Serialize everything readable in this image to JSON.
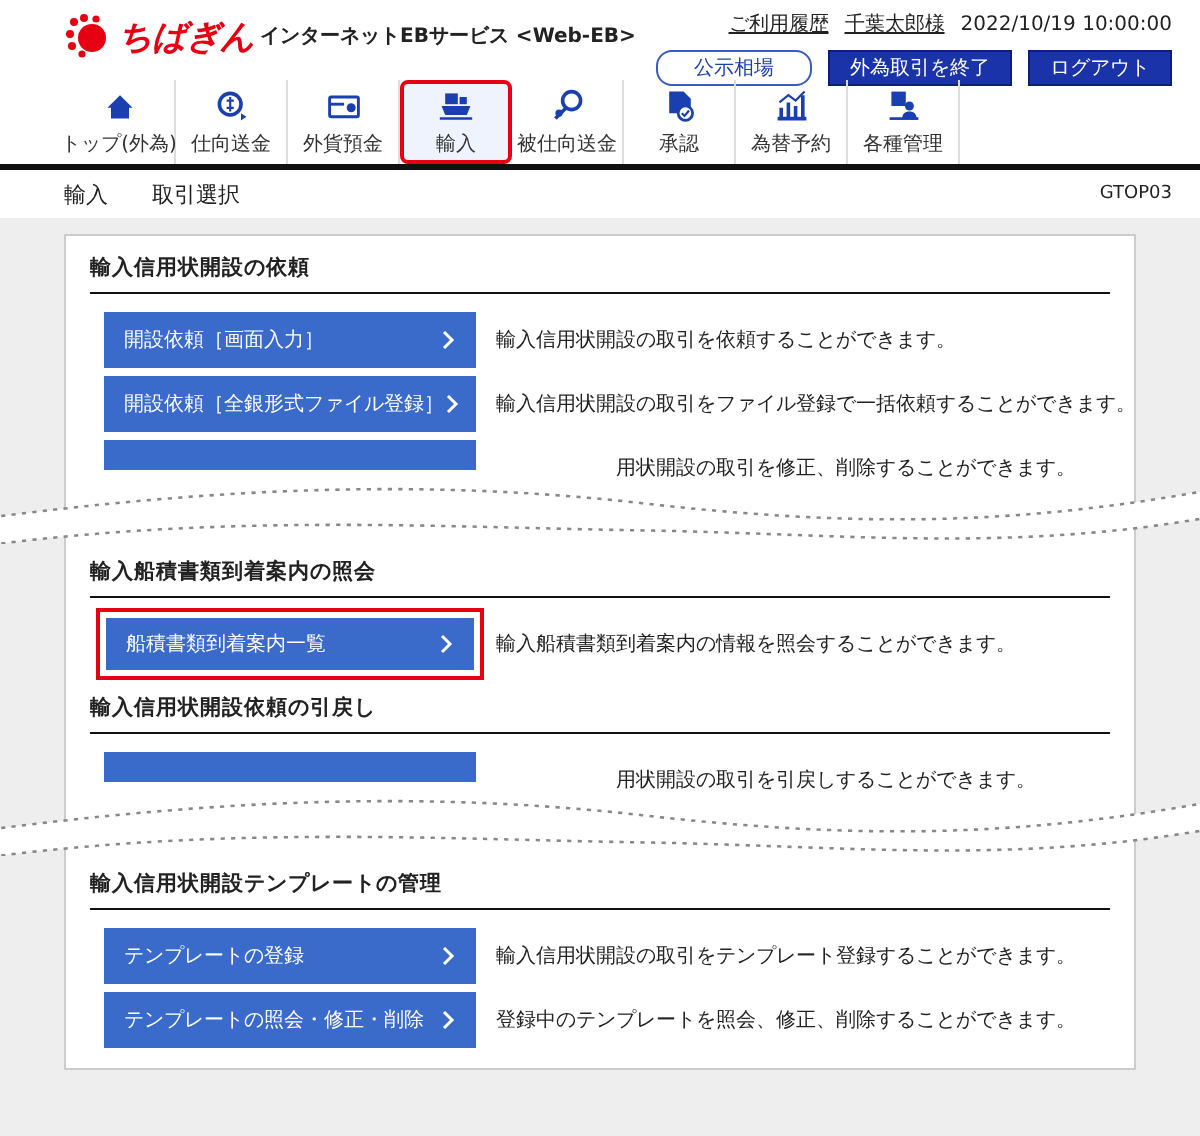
{
  "header": {
    "logo_text": "ちばぎん",
    "service_name": "インターネットEBサービス <Web-EB>",
    "links": [
      "ご利用履歴",
      "千葉太郎様"
    ],
    "datetime": "2022/10/19 10:00:00",
    "buttons": [
      {
        "label": "公示相場",
        "kind": "outline"
      },
      {
        "label": "外為取引を終了",
        "kind": "solid"
      },
      {
        "label": "ログアウト",
        "kind": "solid"
      }
    ]
  },
  "nav": [
    {
      "label": "トップ(外為)",
      "selected": false
    },
    {
      "label": "仕向送金",
      "selected": false
    },
    {
      "label": "外貨預金",
      "selected": false
    },
    {
      "label": "輸入",
      "selected": true
    },
    {
      "label": "被仕向送金",
      "selected": false
    },
    {
      "label": "承認",
      "selected": false
    },
    {
      "label": "為替予約",
      "selected": false
    },
    {
      "label": "各種管理",
      "selected": false
    }
  ],
  "breadcrumb": [
    "輸入",
    "取引選択"
  ],
  "screen_id": "GTOP03",
  "sections": [
    {
      "title": "輸入信用状開設の依頼",
      "items": [
        {
          "kind": "full",
          "label": "開設依頼［画面入力］",
          "description": "輸入信用状開設の取引を依頼することができます。",
          "highlighted": false
        },
        {
          "kind": "full",
          "label": "開設依頼［全銀形式ファイル登録］",
          "description": "輸入信用状開設の取引をファイル登録で一括依頼することができます。",
          "highlighted": false
        },
        {
          "kind": "cut",
          "description": "用状開設の取引を修正、削除することができます。"
        }
      ]
    },
    {
      "title": "輸入船積書類到着案内の照会",
      "items": [
        {
          "kind": "full",
          "label": "船積書類到着案内一覧",
          "description": "輸入船積書類到着案内の情報を照会することができます。",
          "highlighted": true
        }
      ]
    },
    {
      "title": "輸入信用状開設依頼の引戻し",
      "items": [
        {
          "kind": "cut",
          "description": "用状開設の取引を引戻しすることができます。"
        }
      ]
    },
    {
      "title": "輸入信用状開設テンプレートの管理",
      "items": [
        {
          "kind": "full",
          "label": "テンプレートの登録",
          "description": "輸入信用状開設の取引をテンプレート登録することができます。",
          "highlighted": false
        },
        {
          "kind": "full",
          "label": "テンプレートの照会・修正・削除",
          "description": "登録中のテンプレートを照会、修正、削除することができます。",
          "highlighted": false
        }
      ]
    }
  ]
}
